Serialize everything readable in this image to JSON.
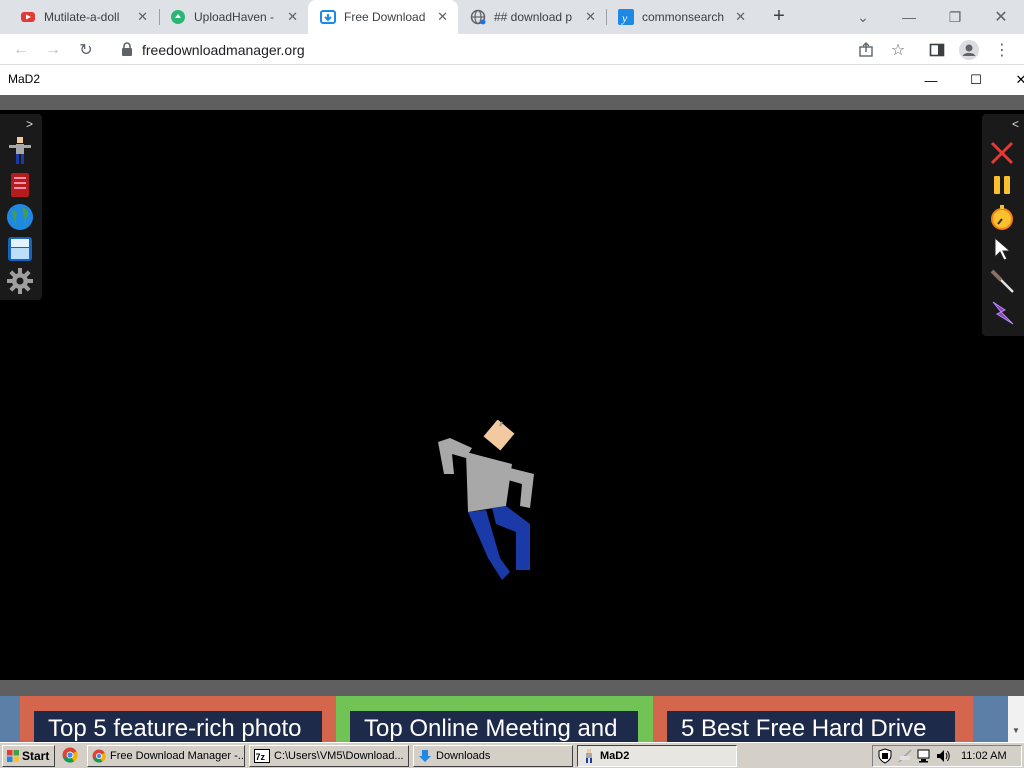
{
  "browser": {
    "tabs": [
      {
        "title": "Mutilate-a-doll",
        "icon": "youtube-like-red-icon"
      },
      {
        "title": "UploadHaven -",
        "icon": "uploadhaven-icon"
      },
      {
        "title": "Free Download",
        "icon": "fdm-icon",
        "active": true
      },
      {
        "title": "## download p",
        "icon": "globe-icon"
      },
      {
        "title": "commonsearch",
        "icon": "yahoo-icon"
      }
    ],
    "new_tab": "+",
    "url": "freedownloadmanager.org"
  },
  "app": {
    "title": "MaD2"
  },
  "left_panel": {
    "toggle": ">",
    "items": [
      "ragdoll-icon",
      "book-icon",
      "globe-icon",
      "save-icon",
      "settings-gear-icon"
    ]
  },
  "right_panel": {
    "toggle": "<",
    "items": [
      "close-x-icon",
      "pause-icon",
      "stopwatch-icon",
      "pointer-cursor-icon",
      "knife-icon",
      "lightning-icon"
    ]
  },
  "page_cards": [
    {
      "text": "Top 5 feature-rich photo",
      "color": "#d4664e"
    },
    {
      "text": "Top Online Meeting and",
      "color": "#72c356"
    },
    {
      "text": "5 Best Free Hard Drive",
      "color": "#d4664e"
    }
  ],
  "taskbar": {
    "start": "Start",
    "buttons": [
      {
        "label": "Free Download Manager -..."
      },
      {
        "label": "C:\\Users\\VM5\\Download..."
      },
      {
        "label": "Downloads"
      },
      {
        "label": "MaD2",
        "active": true
      }
    ],
    "clock": "11:02 AM"
  },
  "colors": {
    "game_bg": "#000000",
    "ragdoll_shirt": "#a8a8a8",
    "ragdoll_pants": "#1a3aa8",
    "ragdoll_skin": "#f3c9a0"
  }
}
